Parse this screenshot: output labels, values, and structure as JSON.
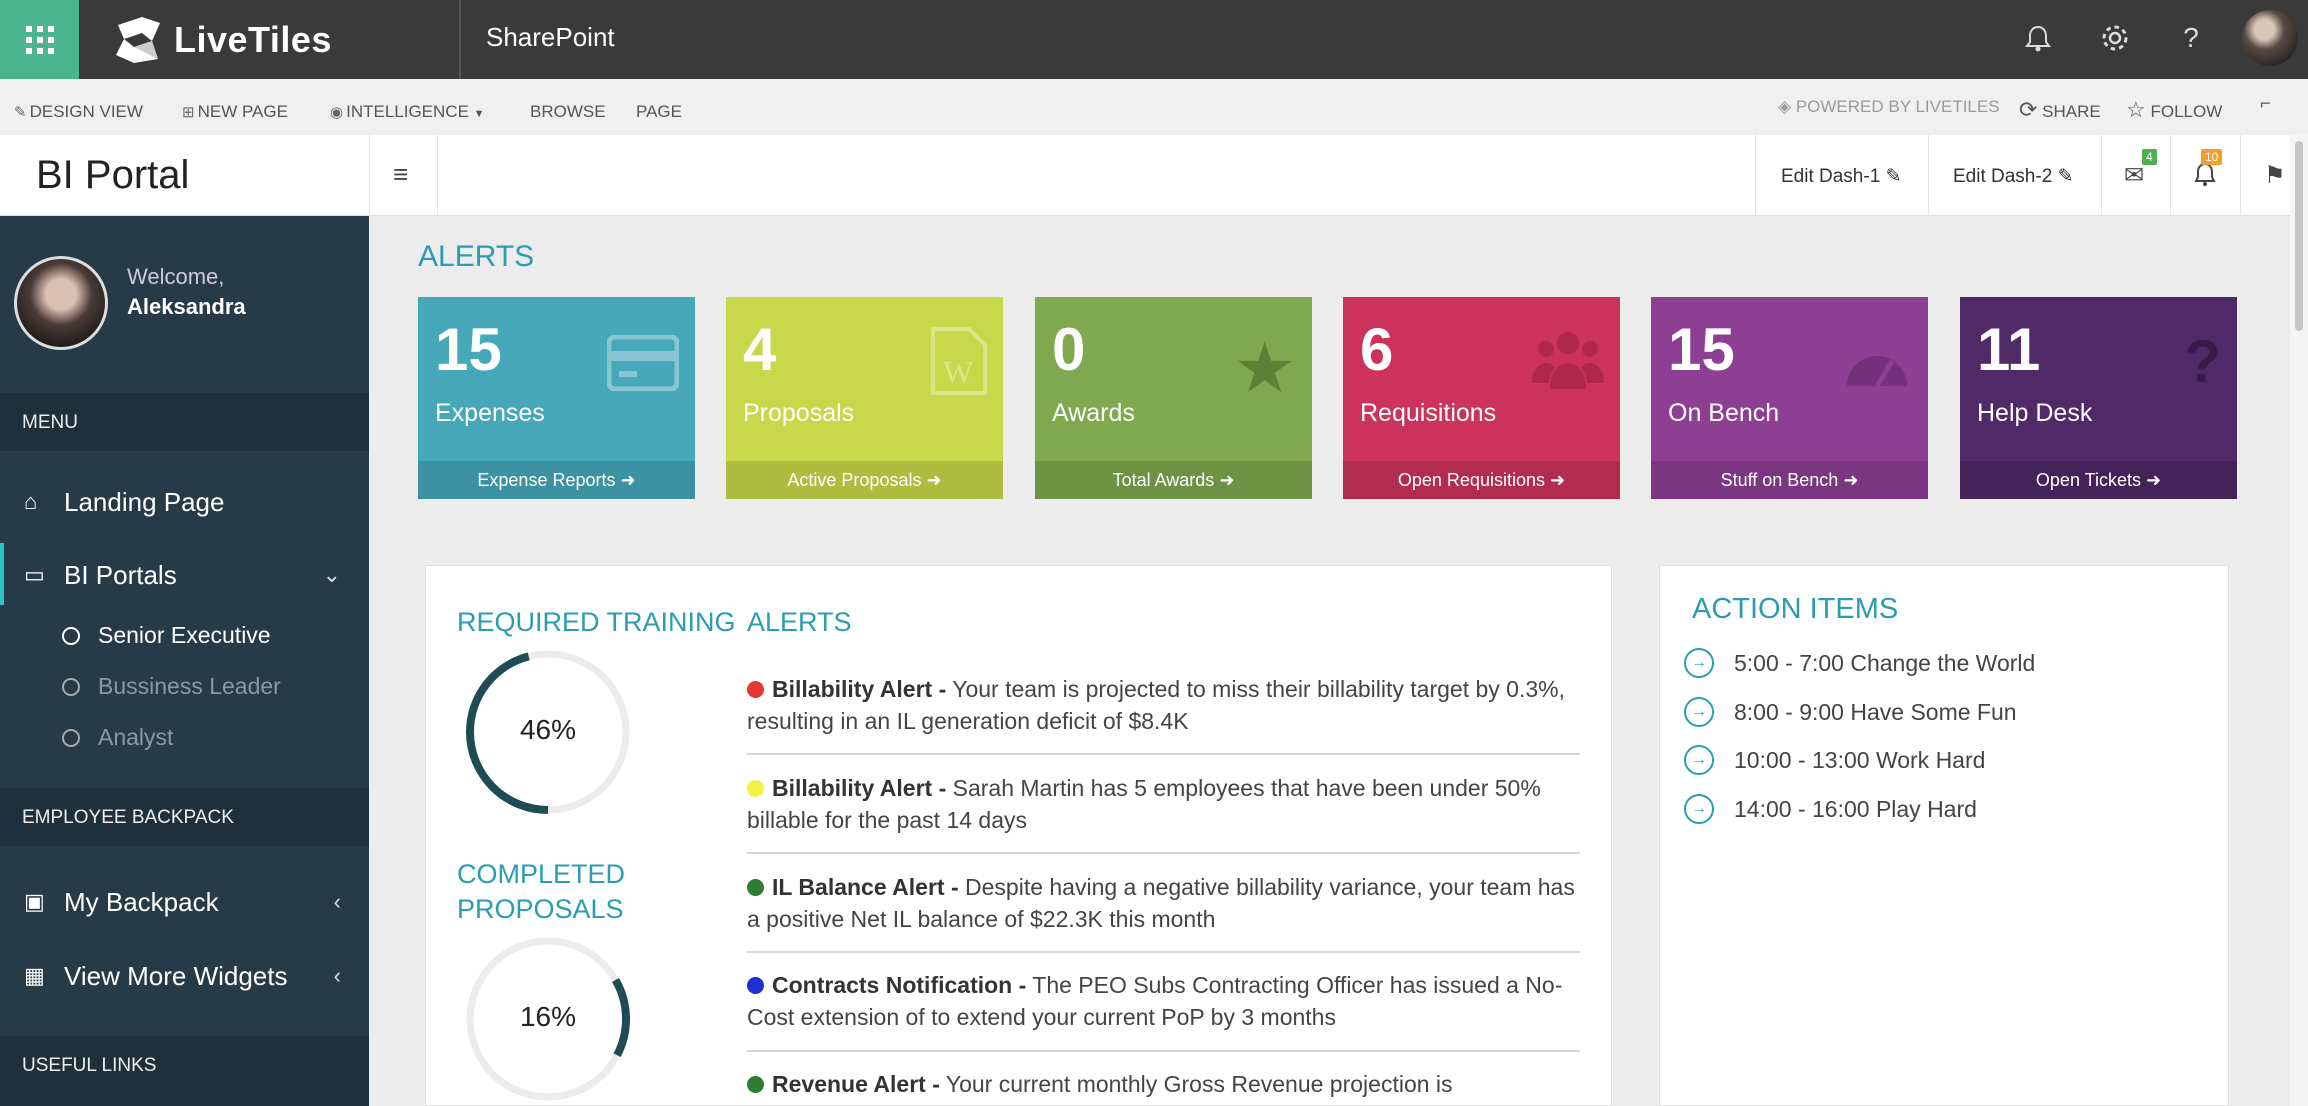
{
  "suite_bar": {
    "app_launcher_icon": "waffle-icon",
    "logo_text": "LiveTiles",
    "title": "SharePoint",
    "icons": [
      "bell-icon",
      "gear-icon",
      "help-icon"
    ]
  },
  "ribbon": {
    "design_view": "DESIGN VIEW",
    "new_page": "NEW PAGE",
    "intelligence": "INTELLIGENCE",
    "browse": "BROWSE",
    "page": "PAGE",
    "powered_by": "POWERED BY LIVETILES",
    "share": "SHARE",
    "follow": "FOLLOW"
  },
  "header": {
    "portal_title": "BI Portal",
    "edit_dash_1": "Edit Dash-1",
    "edit_dash_2": "Edit Dash-2",
    "mail_badge": "4",
    "bell_badge": "10"
  },
  "sidebar": {
    "welcome": "Welcome,",
    "user_name": "Aleksandra",
    "menu_header": "MENU",
    "landing_page": "Landing Page",
    "bi_portals": "BI Portals",
    "sub_items": [
      "Senior Executive",
      "Bussiness Leader",
      "Analyst"
    ],
    "employee_backpack_header": "EMPLOYEE BACKPACK",
    "my_backpack": "My Backpack",
    "view_more_widgets": "View More Widgets",
    "useful_links_header": "USEFUL LINKS"
  },
  "alerts_section": {
    "title": "ALERTS",
    "tiles": [
      {
        "value": "15",
        "label": "Expenses",
        "footer": "Expense Reports",
        "color": "#46a8b8",
        "icon": "credit-card-icon"
      },
      {
        "value": "4",
        "label": "Proposals",
        "footer": "Active Proposals",
        "color": "#c7d94a",
        "icon": "word-document-icon"
      },
      {
        "value": "0",
        "label": "Awards",
        "footer": "Total Awards",
        "color": "#7fa84f",
        "icon": "star-icon"
      },
      {
        "value": "6",
        "label": "Requisitions",
        "footer": "Open Requisitions",
        "color": "#cc335b",
        "icon": "users-icon"
      },
      {
        "value": "15",
        "label": "On Bench",
        "footer": "Stuff on Bench",
        "color": "#8d3f94",
        "icon": "dashboard-gauge-icon"
      },
      {
        "value": "11",
        "label": "Help Desk",
        "footer": "Open Tickets",
        "color": "#4f2a66",
        "icon": "question-icon"
      }
    ]
  },
  "training": {
    "required_title": "REQUIRED TRAINING",
    "required_value": "46%",
    "required_percent": 46,
    "completed_title_line1": "COMPLETED",
    "completed_title_line2": "PROPOSALS",
    "completed_value": "16%",
    "completed_percent": 16
  },
  "alerts_list": {
    "title": "ALERTS",
    "items": [
      {
        "color": "#e53935",
        "title": "Billability Alert -",
        "text": "Your team is projected to miss their billability target by 0.3%, resulting in an IL generation deficit of $8.4K"
      },
      {
        "color": "#f4f04a",
        "title": "Billability Alert -",
        "text": "Sarah Martin has 5 employees that have been under 50% billable for the past 14 days"
      },
      {
        "color": "#2e7d32",
        "title": "IL Balance Alert -",
        "text": "Despite having a negative billability variance, your team has a positive Net IL balance of $22.3K this month"
      },
      {
        "color": "#1e2fd6",
        "title": "Contracts Notification -",
        "text": "The PEO Subs Contracting Officer has issued a No-Cost extension of to extend your current PoP by 3 months"
      },
      {
        "color": "#2e7d32",
        "title": "Revenue Alert -",
        "text": "Your current monthly Gross Revenue projection is"
      }
    ]
  },
  "action_items": {
    "title": "ACTION ITEMS",
    "items": [
      "5:00 - 7:00 Change the World",
      "8:00 - 9:00 Have Some Fun",
      "10:00 - 13:00 Work Hard",
      "14:00 - 16:00 Play Hard"
    ]
  }
}
